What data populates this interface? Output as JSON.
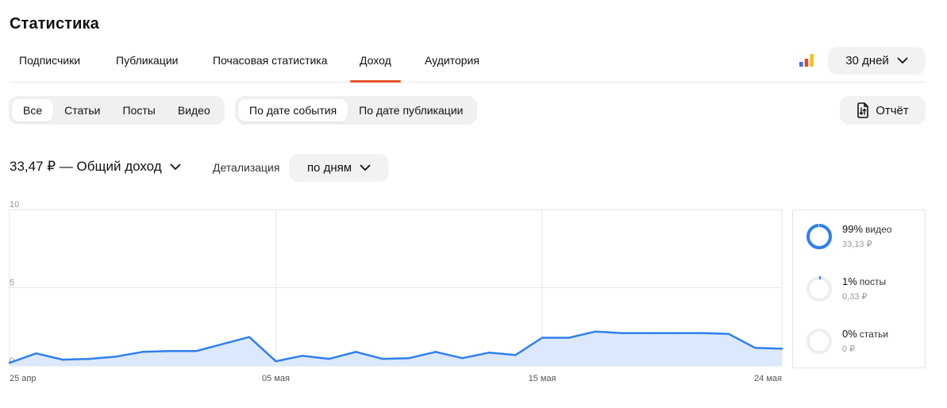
{
  "page_title": "Статистика",
  "tabs": [
    {
      "label": "Подписчики",
      "active": false
    },
    {
      "label": "Публикации",
      "active": false
    },
    {
      "label": "Почасовая статистика",
      "active": false
    },
    {
      "label": "Доход",
      "active": true
    },
    {
      "label": "Аудитория",
      "active": false
    }
  ],
  "period_select": {
    "label": "30 дней"
  },
  "content_filter": [
    {
      "label": "Все",
      "active": true
    },
    {
      "label": "Статьи",
      "active": false
    },
    {
      "label": "Посты",
      "active": false
    },
    {
      "label": "Видео",
      "active": false
    }
  ],
  "date_filter": [
    {
      "label": "По дате события",
      "active": true
    },
    {
      "label": "По дате публикации",
      "active": false
    }
  ],
  "report_button": {
    "label": "Отчёт"
  },
  "total": {
    "label": "33,47 ₽ — Общий доход"
  },
  "detail": {
    "label": "Детализация",
    "select": "по дням"
  },
  "colors": {
    "accent": "#e8572f",
    "line": "#2f80ed",
    "fill": "#dce8fb",
    "ring_bg": "#eeeeee"
  },
  "chart_data": {
    "type": "area",
    "x": [
      "25 апр",
      "26 апр",
      "27 апр",
      "28 апр",
      "29 апр",
      "30 апр",
      "01 мая",
      "02 мая",
      "03 мая",
      "04 мая",
      "05 мая",
      "06 мая",
      "07 мая",
      "08 мая",
      "09 мая",
      "10 мая",
      "11 мая",
      "12 мая",
      "13 мая",
      "14 мая",
      "15 мая",
      "16 мая",
      "17 мая",
      "18 мая",
      "19 мая",
      "20 мая",
      "21 мая",
      "22 мая",
      "23 мая",
      "24 мая"
    ],
    "values": [
      0.2,
      0.8,
      0.4,
      0.45,
      0.6,
      0.9,
      0.95,
      0.95,
      1.4,
      1.85,
      0.3,
      0.65,
      0.45,
      0.9,
      0.45,
      0.5,
      0.9,
      0.5,
      0.85,
      0.7,
      1.8,
      1.8,
      2.2,
      2.1,
      2.1,
      2.1,
      2.1,
      2.05,
      1.15,
      1.1
    ],
    "x_ticks": [
      "25 апр",
      "05 мая",
      "15 мая",
      "24 мая"
    ],
    "y_ticks": [
      0,
      5,
      10
    ],
    "ylim": [
      0,
      10
    ],
    "grid": true,
    "title": "",
    "xlabel": "",
    "ylabel": ""
  },
  "breakdown": [
    {
      "percent": "99%",
      "kind": "видео",
      "value": "33,13 ₽",
      "fraction": 0.99
    },
    {
      "percent": "1%",
      "kind": "посты",
      "value": "0,33 ₽",
      "fraction": 0.01
    },
    {
      "percent": "0%",
      "kind": "статьи",
      "value": "0 ₽",
      "fraction": 0.0
    }
  ]
}
